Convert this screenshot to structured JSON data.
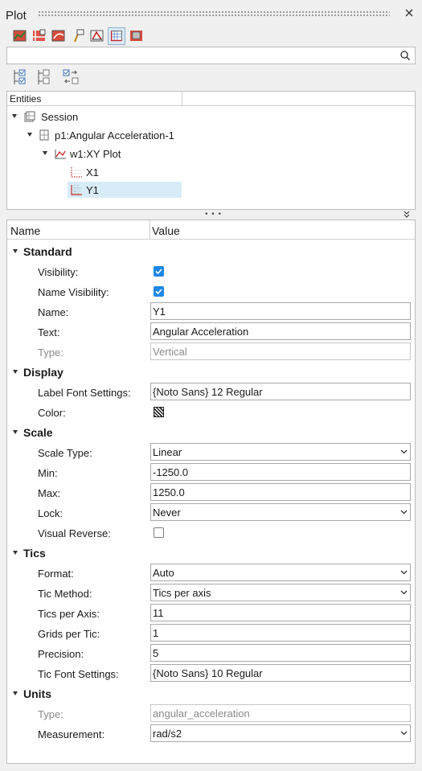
{
  "panel": {
    "title": "Plot"
  },
  "toolbar": {
    "buttons": [
      "plot-icon",
      "axis-icon",
      "curve-icon",
      "note-icon",
      "datum-icon",
      "grid-icon",
      "legend-icon"
    ],
    "active": "grid-icon"
  },
  "search": {
    "value": "",
    "placeholder": ""
  },
  "toolbar2": {
    "buttons": [
      "check-tree-icon",
      "tree-structure-icon",
      "sync-icon"
    ]
  },
  "entities": {
    "header": "Entities",
    "tree": [
      {
        "label": "Session",
        "icon": "session-icon",
        "selected": false
      },
      {
        "label": "p1:Angular Acceleration-1",
        "icon": "page-icon",
        "selected": false
      },
      {
        "label": "w1:XY Plot",
        "icon": "xy-plot-icon",
        "selected": false
      },
      {
        "label": "X1",
        "icon": "x-axis-icon",
        "selected": false
      },
      {
        "label": "Y1",
        "icon": "y-axis-icon",
        "selected": true
      }
    ]
  },
  "properties": {
    "col_name": "Name",
    "col_value": "Value",
    "sections": [
      {
        "title": "Standard",
        "rows": [
          {
            "label": "Visibility:",
            "type": "checkbox",
            "checked": true
          },
          {
            "label": "Name Visibility:",
            "type": "checkbox",
            "checked": true
          },
          {
            "label": "Name:",
            "type": "text",
            "value": "Y1"
          },
          {
            "label": "Text:",
            "type": "text",
            "value": "Angular Acceleration"
          },
          {
            "label": "Type:",
            "type": "text",
            "value": "Vertical",
            "disabled": true
          }
        ]
      },
      {
        "title": "Display",
        "rows": [
          {
            "label": "Label Font Settings:",
            "type": "text",
            "value": "{Noto Sans} 12 Regular"
          },
          {
            "label": "Color:",
            "type": "color",
            "value": "#222222"
          }
        ]
      },
      {
        "title": "Scale",
        "rows": [
          {
            "label": "Scale Type:",
            "type": "select",
            "value": "Linear"
          },
          {
            "label": "Min:",
            "type": "text",
            "value": "-1250.0"
          },
          {
            "label": "Max:",
            "type": "text",
            "value": "1250.0"
          },
          {
            "label": "Lock:",
            "type": "select",
            "value": "Never"
          },
          {
            "label": "Visual Reverse:",
            "type": "checkbox",
            "checked": false
          }
        ]
      },
      {
        "title": "Tics",
        "rows": [
          {
            "label": "Format:",
            "type": "select",
            "value": "Auto"
          },
          {
            "label": "Tic Method:",
            "type": "select",
            "value": "Tics per axis"
          },
          {
            "label": "Tics per Axis:",
            "type": "text",
            "value": "11"
          },
          {
            "label": "Grids per Tic:",
            "type": "text",
            "value": "1"
          },
          {
            "label": "Precision:",
            "type": "text",
            "value": "5"
          },
          {
            "label": "Tic Font Settings:",
            "type": "text",
            "value": "{Noto Sans} 10 Regular"
          }
        ]
      },
      {
        "title": "Units",
        "rows": [
          {
            "label": "Type:",
            "type": "text",
            "value": "angular_acceleration",
            "disabled": true
          },
          {
            "label": "Measurement:",
            "type": "select",
            "value": "rad/s2"
          }
        ]
      }
    ]
  }
}
